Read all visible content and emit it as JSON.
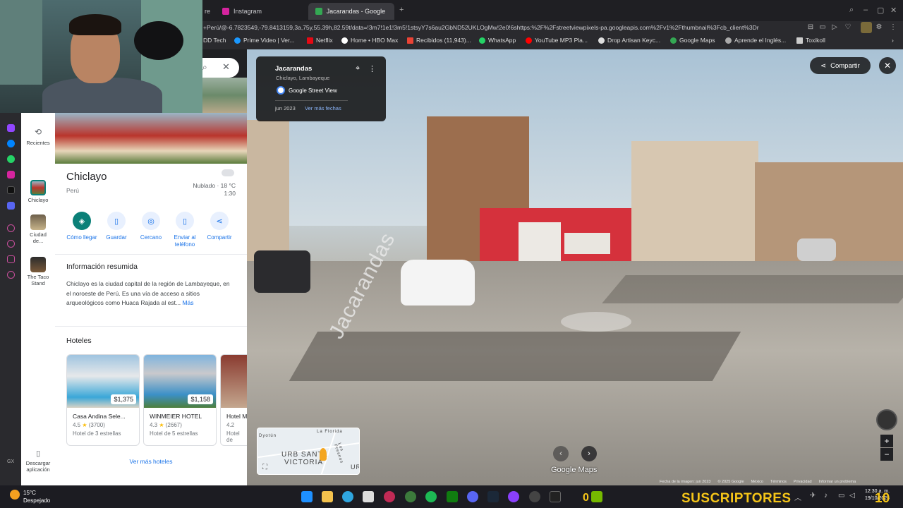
{
  "browser": {
    "tabs": [
      {
        "label": "Instagram"
      },
      {
        "label": "Jacarandas - Google Maps"
      }
    ],
    "tab_partial": "re",
    "url": "+Perú/@-6.7823549,-79.8413159,3a,75y,55.39h,82.59t/data=!3m7!1e1!3m5!1stsyY7s6au2GbND52UKLOgMw!2e0!6shttps:%2F%2Fstreetviewpixels-pa.googleapis.com%2Fv1%2Fthumbnail%3Fcb_client%3Dr",
    "bookmarks": [
      "DD Tech",
      "Prime Video | Ver...",
      "Netflix",
      "Home • HBO Max",
      "Recibidos (11,943)...",
      "WhatsApp",
      "YouTube MP3 Pla...",
      "Drop Artisan Keyc...",
      "Google Maps",
      "Aprende el Inglés...",
      "Toxikoll"
    ]
  },
  "nav": {
    "recent": "Recientes",
    "items": [
      {
        "label": "Chiclayo"
      },
      {
        "label": "Ciudad de..."
      },
      {
        "label": "The Taco Stand"
      }
    ],
    "download": "Descargar aplicación"
  },
  "place": {
    "title": "Chiclayo",
    "country": "Perú",
    "weather_line1": "Nublado · 18 °C",
    "weather_line2": "1:30",
    "actions": [
      "Cómo llegar",
      "Guardar",
      "Cercano",
      "Enviar al teléfono",
      "Compartir"
    ],
    "summary_title": "Información resumida",
    "summary_text": "Chiclayo es la ciudad capital de la región de Lambayeque, en el noroeste de Perú. Es una vía de acceso a sitios arqueológicos como Huaca Rajada al est...",
    "summary_more": "Más",
    "hotels_title": "Hoteles",
    "hotels": [
      {
        "price": "$1,375",
        "name": "Casa Andina Sele...",
        "rating": "4.5",
        "reviews": "(3700)",
        "class": "Hotel de 3 estrellas"
      },
      {
        "price": "$1,158",
        "name": "WINMEIER HOTEL",
        "rating": "4.3",
        "reviews": "(2667)",
        "class": "Hotel de 5 estrellas"
      },
      {
        "price": "",
        "name": "Hotel M",
        "rating": "4.2",
        "reviews": "",
        "class": "Hotel de"
      }
    ],
    "more_hotels": "Ver más hoteles"
  },
  "streetview": {
    "card_title": "Jacarandas",
    "card_subtitle": "Chiclayo, Lambayeque",
    "card_source": "Google Street View",
    "card_date": "jun 2023",
    "card_link": "Ver más fechas",
    "share": "Compartir",
    "street_label": "Jacarandas",
    "logo": "Google Maps",
    "minimap_labels": [
      "La Florida",
      "URB SANTA",
      "VICTORIA",
      "Los Fresnos",
      "Dyotún",
      "UR"
    ],
    "footer": [
      "Fecha de la imagen: jun 2023",
      "© 2025 Google",
      "México",
      "Términos",
      "Privacidad",
      "Informar un problema"
    ]
  },
  "taskbar": {
    "weather_temp": "15°C",
    "weather_desc": "Despejado",
    "overlay_count": "0",
    "subscribers_label": "SUSCRIPTORES",
    "subscribers_count": "10",
    "clock_time": "12:30 a. m.",
    "clock_date": "19/10/2025"
  },
  "colors": {
    "primary_action": "#0b8078",
    "link": "#1a73e8",
    "subs": "#f5c518"
  }
}
